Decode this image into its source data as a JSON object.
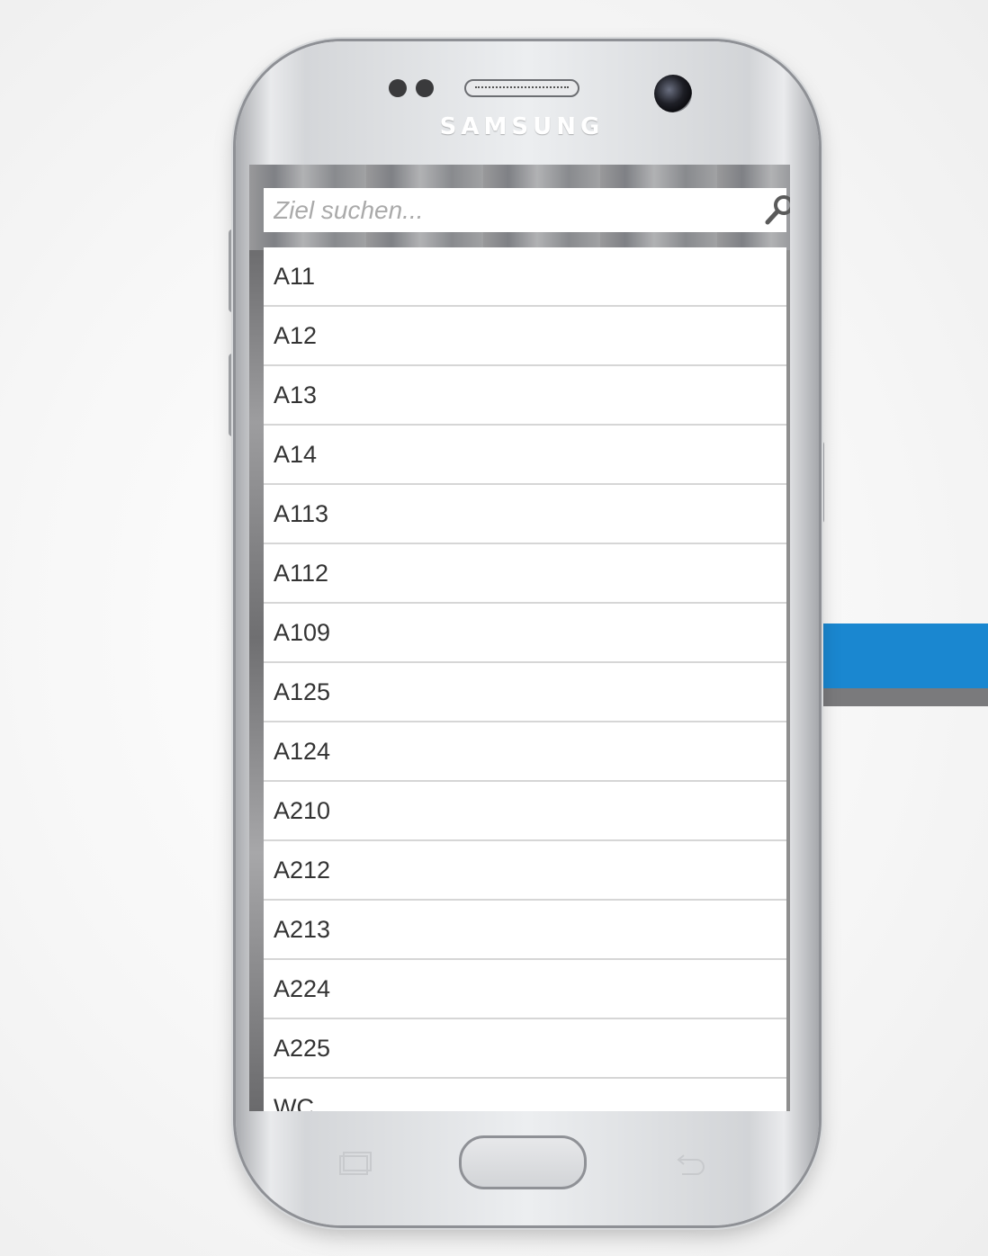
{
  "device": {
    "brand": "SAMSUNG"
  },
  "search": {
    "placeholder": "Ziel suchen...",
    "value": ""
  },
  "destinations": [
    {
      "label": "A11"
    },
    {
      "label": "A12"
    },
    {
      "label": "A13"
    },
    {
      "label": "A14"
    },
    {
      "label": "A113"
    },
    {
      "label": "A112"
    },
    {
      "label": "A109"
    },
    {
      "label": "A125"
    },
    {
      "label": "A124"
    },
    {
      "label": "A210"
    },
    {
      "label": "A212"
    },
    {
      "label": "A213"
    },
    {
      "label": "A224"
    },
    {
      "label": "A225"
    },
    {
      "label": "WC"
    }
  ],
  "colors": {
    "accent": "#1a87d0",
    "list_background": "#ffffff",
    "divider": "#d6d6d6",
    "text": "#333333"
  },
  "icons": {
    "search": "search-icon",
    "recent_apps": "recent-apps-icon",
    "back": "back-icon"
  }
}
